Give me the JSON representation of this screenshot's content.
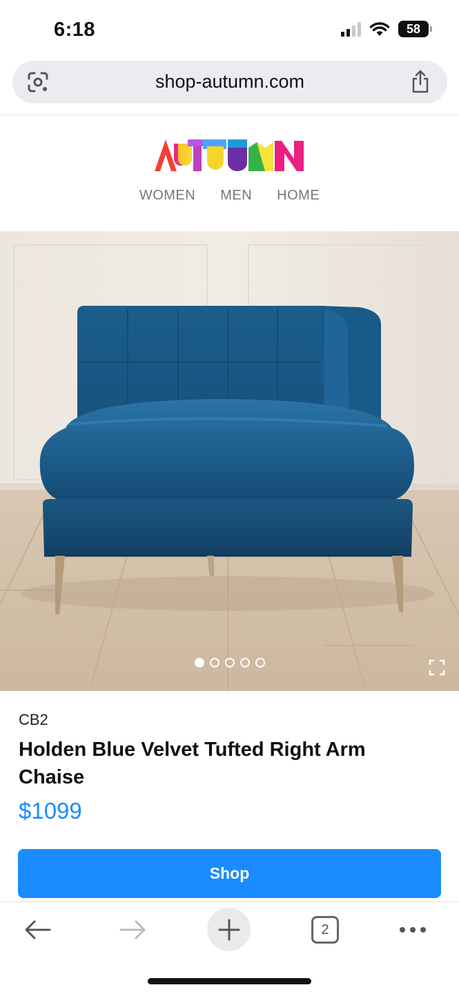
{
  "status_bar": {
    "time": "6:18",
    "battery": "58"
  },
  "browser": {
    "url": "shop-autumn.com",
    "tab_count": "2"
  },
  "site": {
    "logo": "AUTUMN",
    "nav": [
      "WOMEN",
      "MEN",
      "HOME"
    ]
  },
  "product": {
    "brand": "CB2",
    "title": "Holden Blue Velvet Tufted Right Arm Chaise",
    "price": "$1099",
    "image_count": 5,
    "active_image": 1
  },
  "actions": {
    "shop_label": "Shop"
  },
  "colors": {
    "accent": "#1a8cff",
    "sofa": "#1d5a85"
  }
}
